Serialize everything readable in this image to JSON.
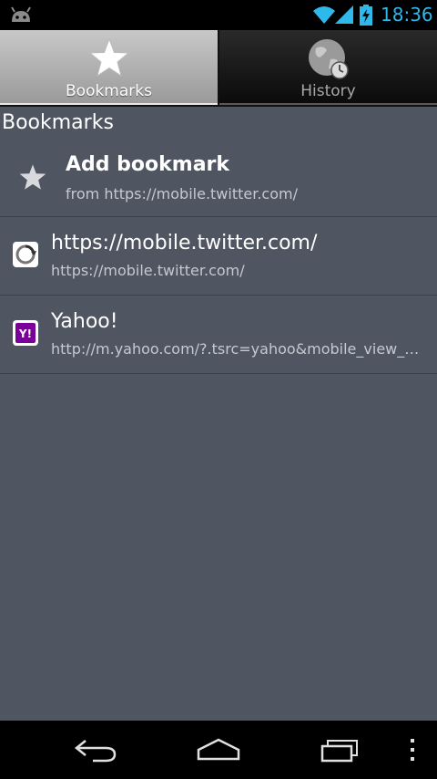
{
  "status_bar": {
    "time": "18:36",
    "icons": [
      "android-debug-icon",
      "wifi-icon",
      "signal-icon",
      "battery-charging-icon"
    ],
    "accent_color": "#2fb8ea"
  },
  "tabs": [
    {
      "label": "Bookmarks",
      "icon": "star-icon",
      "active": true
    },
    {
      "label": "History",
      "icon": "globe-clock-icon",
      "active": false
    }
  ],
  "section_header": "Bookmarks",
  "bookmarks": [
    {
      "title": "Add bookmark",
      "subtitle": "from https://mobile.twitter.com/",
      "icon": "star-icon"
    },
    {
      "title": "https://mobile.twitter.com/",
      "subtitle": "https://mobile.twitter.com/",
      "icon": "twitter-favicon-icon"
    },
    {
      "title": "Yahoo!",
      "subtitle": "http://m.yahoo.com/?.tsrc=yahoo&mobile_view_default=true",
      "icon": "yahoo-favicon-icon"
    }
  ],
  "yahoo_icon_text": "Y!",
  "nav_bar": {
    "buttons": [
      "back-icon",
      "home-icon",
      "recent-apps-icon",
      "menu-icon"
    ]
  }
}
